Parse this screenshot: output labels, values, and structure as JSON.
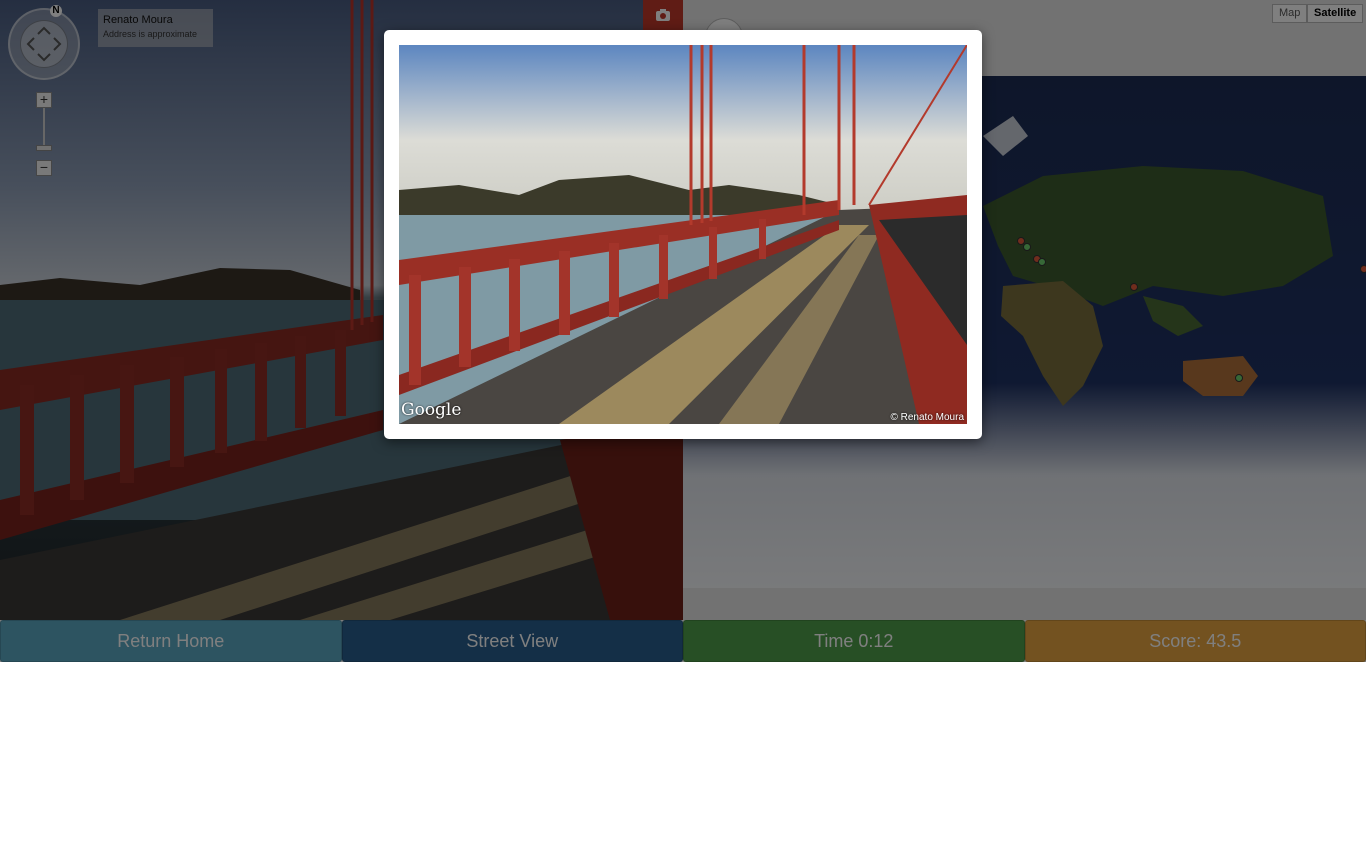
{
  "panorama": {
    "compass_label": "N",
    "zoom_in": "+",
    "zoom_out": "−",
    "info": {
      "name": "Renato Moura",
      "note": "Address is approximate"
    }
  },
  "map": {
    "type_map_label": "Map",
    "type_satellite_label": "Satellite",
    "markers": [
      {
        "color": "#e05a3a"
      },
      {
        "color": "#6fd06f"
      },
      {
        "color": "#e05a3a"
      },
      {
        "color": "#6fd06f"
      },
      {
        "color": "#e05a3a"
      },
      {
        "color": "#6fd06f"
      },
      {
        "color": "#e05a3a"
      }
    ]
  },
  "modal": {
    "google_label": "Google",
    "copyright": "© Renato Moura"
  },
  "bottom_bar": {
    "return_home": "Return Home",
    "street_view": "Street View",
    "time": "Time 0:12",
    "score": "Score: 43.5"
  },
  "colors": {
    "return_home": "#5ba8c3",
    "street_view": "#285f8e",
    "time": "#4f9e4b",
    "score": "#e7a541"
  }
}
